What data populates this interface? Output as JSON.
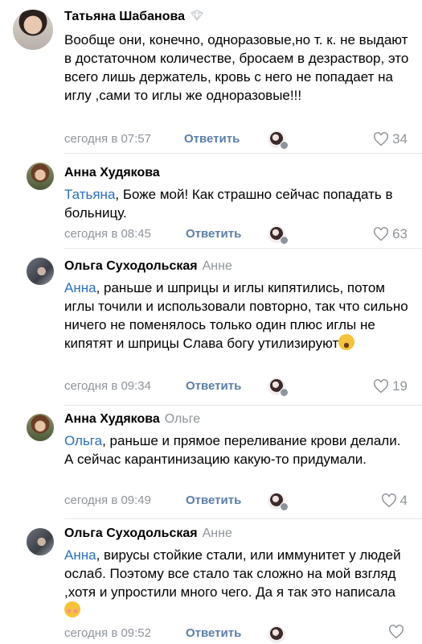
{
  "reply_label": "Ответить",
  "comments": [
    {
      "author": "Татьяна Шабанова",
      "reply_to": "",
      "mention": "",
      "text": "Вообще они, конечно, одноразовые,но т. к. не выдают в достаточном количестве, бросаем в дезраствор, это всего лишь держатель, кровь с него не попадает на иглу ,сами то иглы же одноразовые!!!",
      "time": "сегодня в 07:57",
      "likes": "34"
    },
    {
      "author": "Анна Худякова",
      "reply_to": "",
      "mention": "Татьяна",
      "text": ", Боже мой! Как страшно сейчас попадать в больницу.",
      "time": "сегодня в 08:45",
      "likes": "63"
    },
    {
      "author": "Ольга Суходольская",
      "reply_to": "Анне",
      "mention": "Анна",
      "text": ", раньше и шприцы и иглы кипятились, потом иглы точили и использовали повторно, так что сильно ничего не поменялось только один плюс иглы не кипятят и шприцы Слава богу утилизируют",
      "emoji": "rolling-laughing-emoji",
      "time": "сегодня в 09:34",
      "likes": "19"
    },
    {
      "author": "Анна Худякова",
      "reply_to": "Ольге",
      "mention": "Ольга",
      "text": ", раньше и прямое переливание крови делали. А сейчас карантинизацию какую-то придумали.",
      "time": "сегодня в 09:49",
      "likes": "4"
    },
    {
      "author": "Ольга Суходольская",
      "reply_to": "Анне",
      "mention": "Анна",
      "text": ", вирусы стойкие стали, или иммунитет у людей ослаб. Поэтому все стало так сложно на мой взгляд ,хотя и упростили много чего. Да я так это написала",
      "emoji": "smiling-blush-emoji",
      "time": "сегодня в 09:52",
      "likes": ""
    }
  ],
  "colors": {
    "mention": "#2a6eb8",
    "meta": "#8e949b",
    "reply": "#5b7ea6",
    "divider": "#e4e6e8"
  }
}
